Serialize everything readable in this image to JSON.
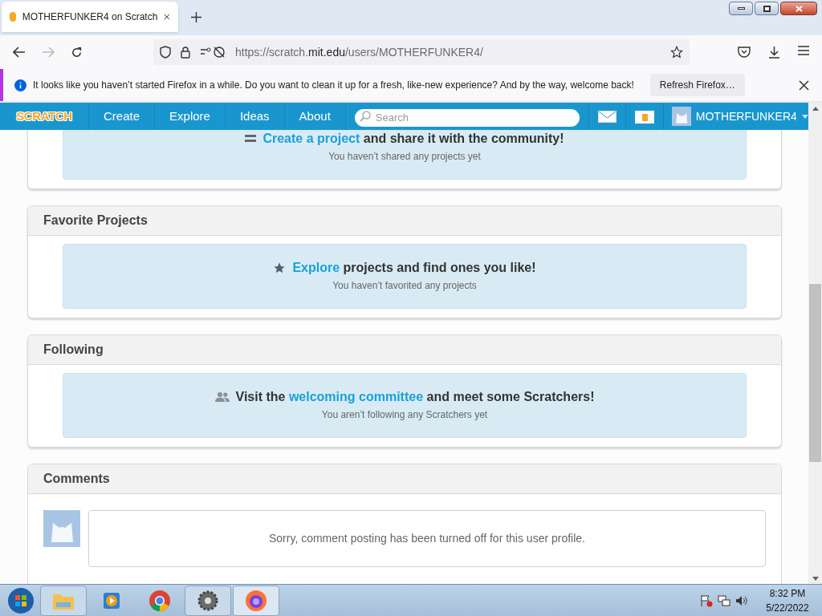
{
  "browser": {
    "tab_title": "MOTHERFUNKER4 on Scratch",
    "url_host": "mit.edu",
    "url_prefix": "https://scratch.",
    "url_rest": "/users/MOTHERFUNKER4/",
    "notification": {
      "text": "It looks like you haven’t started Firefox in a while. Do you want to clean it up for a fresh, like-new experience? And by the way, welcome back!",
      "button": "Refresh Firefox…"
    }
  },
  "nav": {
    "logo": "SCRATCH",
    "items": [
      "Create",
      "Explore",
      "Ideas",
      "About"
    ],
    "search_placeholder": "Search",
    "username": "MOTHERFUNKER4"
  },
  "sections": [
    {
      "kind": "empty",
      "parts": [
        {
          "text": "Create a project",
          "link": true
        },
        {
          "text": " and share it with the community!",
          "link": false
        }
      ],
      "subtext": "You haven’t shared any projects yet"
    },
    {
      "kind": "empty",
      "title": "Favorite Projects",
      "parts": [
        {
          "text": "Explore",
          "link": true
        },
        {
          "text": " projects and find ones you like!",
          "link": false
        }
      ],
      "subtext": "You haven’t favorited any projects"
    },
    {
      "kind": "empty",
      "title": "Following",
      "parts": [
        {
          "text": "Visit the ",
          "link": false
        },
        {
          "text": "welcoming committee",
          "link": true
        },
        {
          "text": " and meet some Scratchers!",
          "link": false
        }
      ],
      "subtext": "You aren’t following any Scratchers yet"
    },
    {
      "kind": "comments",
      "title": "Comments",
      "note": "Sorry, comment posting has been turned off for this user profile."
    }
  ],
  "taskbar": {
    "time": "8:32 PM",
    "date": "5/22/2022"
  }
}
